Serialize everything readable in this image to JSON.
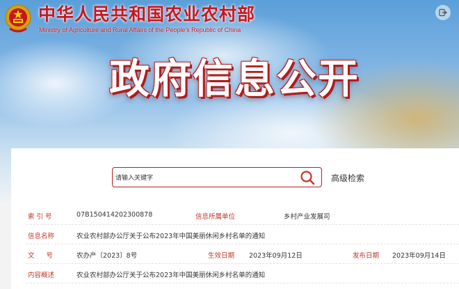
{
  "header": {
    "ministry_name_cn": "中华人民共和国农业农村部",
    "ministry_name_en": "Ministry of Agriculture and Rural Affairs of the People's Republic of China",
    "logout_icon": "logout-icon",
    "brand_color": "#c8161d"
  },
  "hero": {
    "title": "政府信息公开"
  },
  "search": {
    "placeholder": "请输入关键字",
    "button_icon": "search-icon",
    "advanced_label": "高级检索"
  },
  "info": {
    "index_no_label": "索 引 号",
    "index_no_value": "07B150414202300878",
    "dept_label": "信息所属单位",
    "dept_value": "乡村产业发展司",
    "name_label": "信息名称",
    "name_value": "农业农村部办公厅关于公布2023年中国美丽休闲乡村名单的通知",
    "doc_no_label": "文 号",
    "doc_no_value": "农办产〔2023〕8号",
    "effective_date_label": "生效日期",
    "effective_date_value": "2023年09月12日",
    "publish_date_label": "发布日期",
    "publish_date_value": "2023年09月14日",
    "summary_label": "内容概述",
    "summary_value": "农业农村部办公厅关于公布2023年中国美丽休闲乡村名单的通知"
  }
}
